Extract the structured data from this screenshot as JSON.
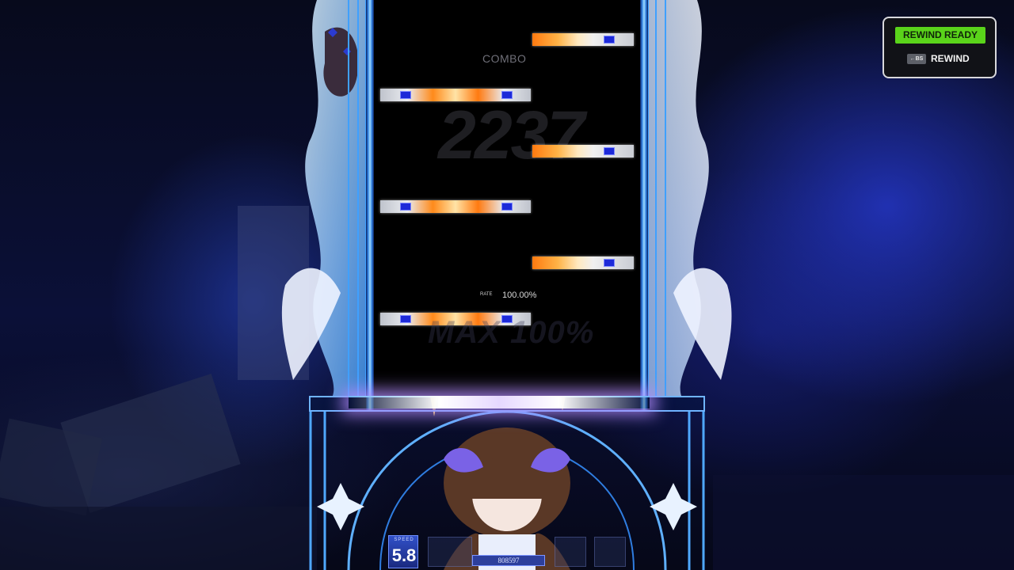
{
  "hud": {
    "combo_label": "COMBO",
    "combo_count": "2237",
    "rate_label": "RATE",
    "rate_value": "100.00%",
    "max_indicator": "MAX 100%",
    "speed_label": "SPEED",
    "speed_value": "5.8",
    "score_value": "808597"
  },
  "rewind": {
    "status": "REWIND READY",
    "key_hint": "←BS",
    "action_label": "REWIND"
  },
  "notes": [
    {
      "lane_group": "right",
      "type": "short"
    },
    {
      "lane_group": "left",
      "type": "long"
    },
    {
      "lane_group": "right",
      "type": "short"
    },
    {
      "lane_group": "left",
      "type": "long"
    },
    {
      "lane_group": "right",
      "type": "short"
    },
    {
      "lane_group": "left",
      "type": "long"
    }
  ],
  "colors": {
    "rewind_ready": "#5ad41a",
    "note_center": "#ff8a1a",
    "note_gem": "#1d2ad8",
    "frame_blue": "#2f7de0"
  },
  "icons": [
    "shield-crest-icon",
    "sparkle-icon",
    "wing-ornament-icon"
  ]
}
